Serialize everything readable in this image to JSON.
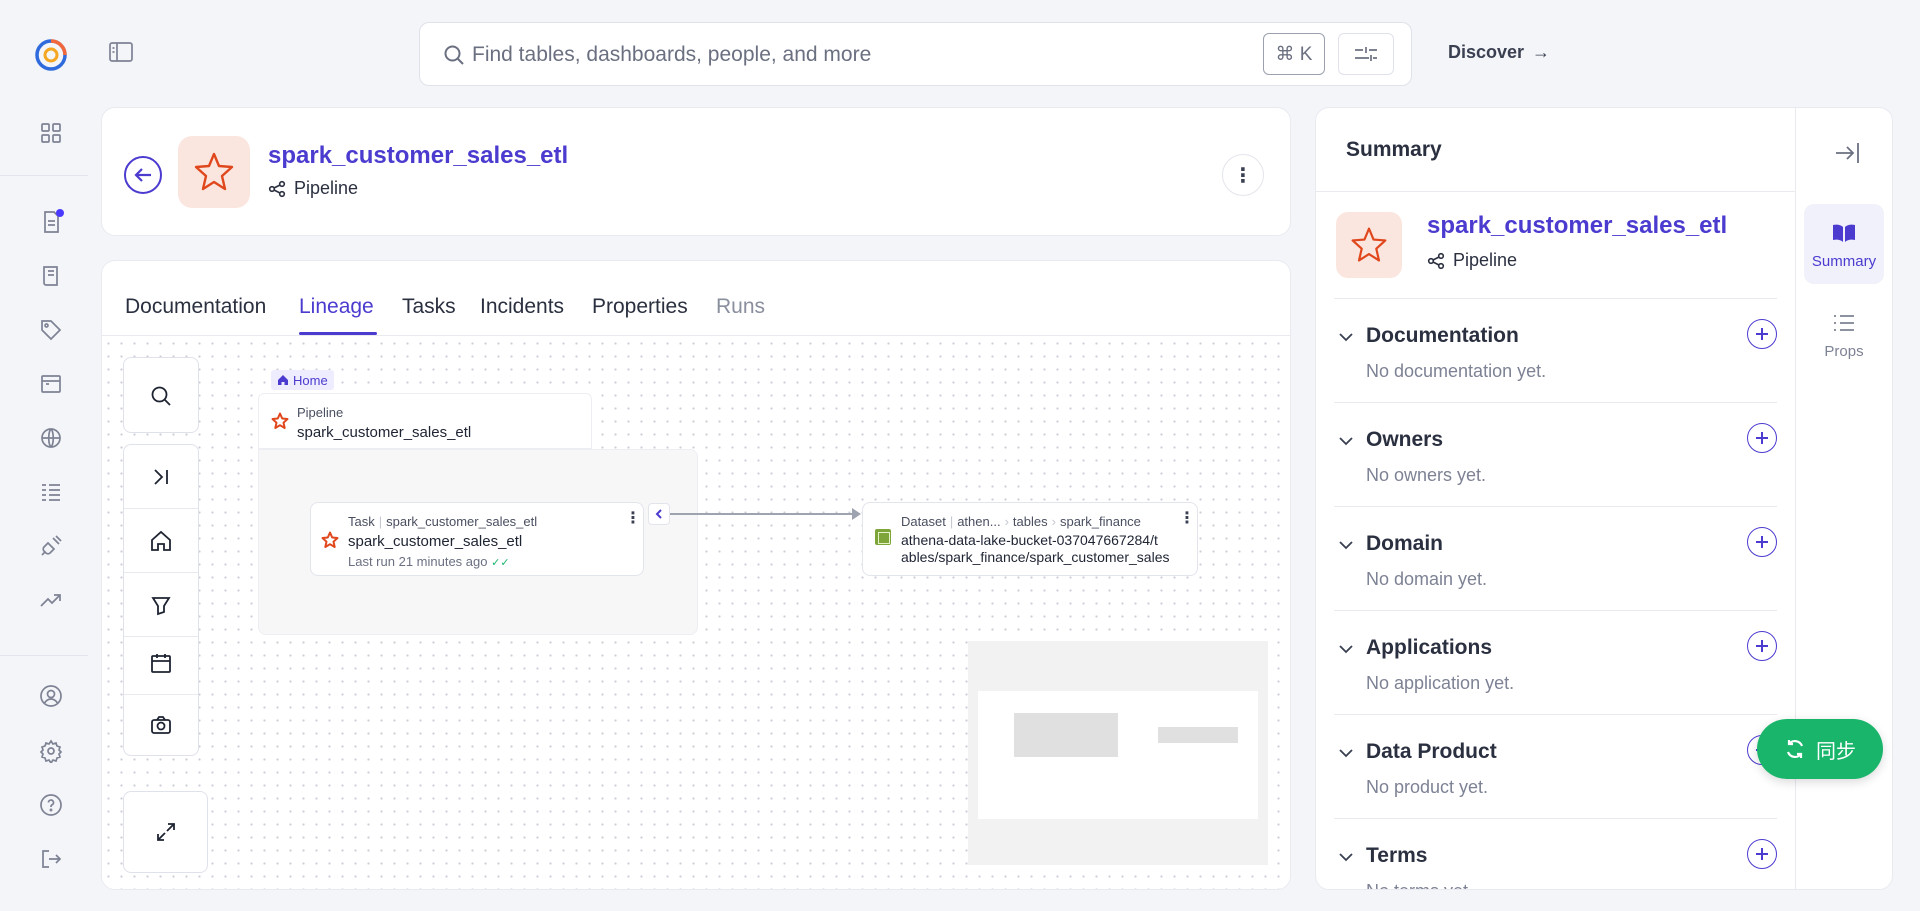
{
  "topbar": {
    "search_placeholder": "Find tables, dashboards, people, and more",
    "shortcut": "⌘ K",
    "discover_label": "Discover",
    "discover_arrow": "→"
  },
  "entity": {
    "name": "spark_customer_sales_etl",
    "type": "Pipeline"
  },
  "tabs": [
    {
      "label": "Documentation",
      "state": "default"
    },
    {
      "label": "Lineage",
      "state": "active"
    },
    {
      "label": "Tasks",
      "state": "default"
    },
    {
      "label": "Incidents",
      "state": "default"
    },
    {
      "label": "Properties",
      "state": "default"
    },
    {
      "label": "Runs",
      "state": "muted"
    }
  ],
  "lineage": {
    "home_tag": "Home",
    "pipeline_group": {
      "type_label": "Pipeline",
      "name": "spark_customer_sales_etl"
    },
    "task_node": {
      "type_label": "Task",
      "breadcrumb": "spark_customer_sales_etl",
      "name": "spark_customer_sales_etl",
      "last_run": "Last run 21 minutes ago"
    },
    "dataset_node": {
      "type_label": "Dataset",
      "breadcrumb": [
        "athen...",
        "tables",
        "spark_finance"
      ],
      "name_line1": "athena-data-lake-bucket-037047667284/t",
      "name_line2": "ables/spark_finance/spark_customer_sales"
    }
  },
  "summary_panel": {
    "title": "Summary",
    "entity_name": "spark_customer_sales_etl",
    "entity_type": "Pipeline",
    "sections": [
      {
        "title": "Documentation",
        "empty": "No documentation yet."
      },
      {
        "title": "Owners",
        "empty": "No owners yet."
      },
      {
        "title": "Domain",
        "empty": "No domain yet."
      },
      {
        "title": "Applications",
        "empty": "No application yet."
      },
      {
        "title": "Data Product",
        "empty": "No product yet."
      },
      {
        "title": "Terms",
        "empty": "No terms yet."
      }
    ],
    "side_tabs": [
      {
        "label": "Summary",
        "state": "active"
      },
      {
        "label": "Props",
        "state": "default"
      }
    ]
  },
  "sync_button": {
    "label": "同步"
  },
  "colors": {
    "accent": "#4b3bcf",
    "pipeline_icon": "#e0471d",
    "sync_green": "#19b56b"
  }
}
